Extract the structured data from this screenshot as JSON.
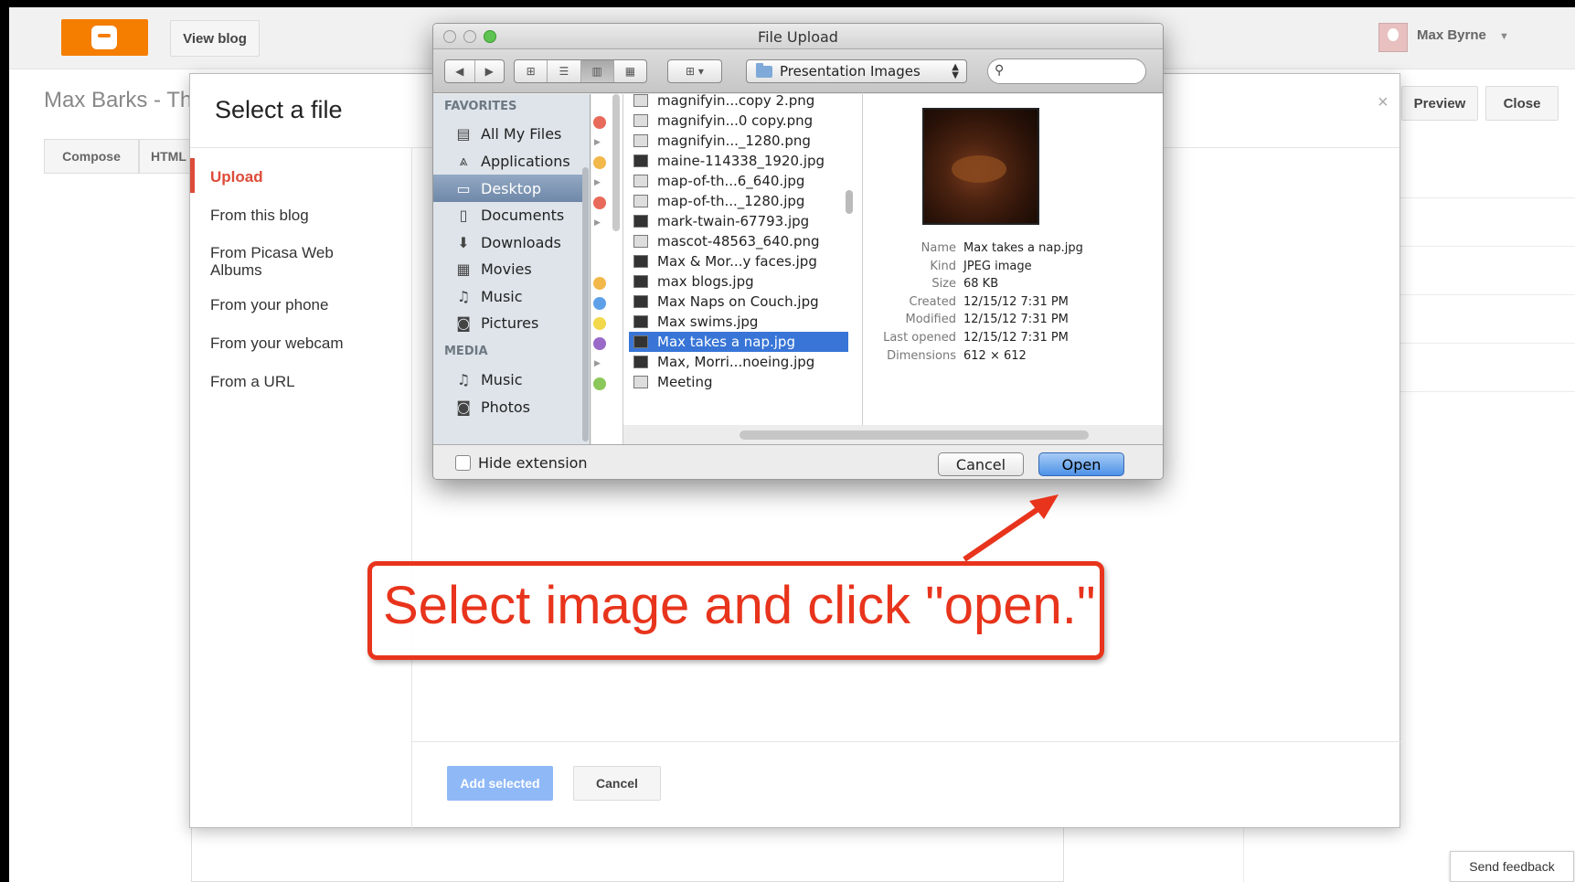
{
  "blogger": {
    "view_blog": "View blog",
    "user_name": "Max Byrne",
    "blog_title": "Max Barks - Th",
    "tab_compose": "Compose",
    "tab_html": "HTML",
    "preview": "Preview",
    "close": "Close",
    "send_feedback": "Send feedback"
  },
  "modal": {
    "title": "Select a file",
    "close_symbol": "×",
    "sidebar": [
      {
        "label": "Upload"
      },
      {
        "label": "From this blog"
      },
      {
        "label": "From Picasa Web Albums"
      },
      {
        "label": "From your phone"
      },
      {
        "label": "From your webcam"
      },
      {
        "label": "From a URL"
      }
    ],
    "add_selected": "Add selected",
    "cancel": "Cancel"
  },
  "dialog": {
    "title": "File Upload",
    "path": "Presentation Images",
    "search_placeholder": "",
    "favorites_header": "FAVORITES",
    "favorites": [
      {
        "label": "All My Files",
        "icon": "all-files-icon",
        "glyph": "▤"
      },
      {
        "label": "Applications",
        "icon": "applications-icon",
        "glyph": "⩓"
      },
      {
        "label": "Desktop",
        "icon": "desktop-icon",
        "glyph": "▭"
      },
      {
        "label": "Documents",
        "icon": "documents-icon",
        "glyph": "▯"
      },
      {
        "label": "Downloads",
        "icon": "downloads-icon",
        "glyph": "⬇"
      },
      {
        "label": "Movies",
        "icon": "movies-icon",
        "glyph": "▦"
      },
      {
        "label": "Music",
        "icon": "music-icon",
        "glyph": "♫"
      },
      {
        "label": "Pictures",
        "icon": "pictures-icon",
        "glyph": "◙"
      }
    ],
    "media_header": "MEDIA",
    "media": [
      {
        "label": "Music",
        "icon": "music-icon",
        "glyph": "♫"
      },
      {
        "label": "Photos",
        "icon": "photos-icon",
        "glyph": "◙"
      }
    ],
    "files": [
      "magnifyin...copy 2.png",
      "magnifyin...0 copy.png",
      "magnifyin..._1280.png",
      "maine-114338_1920.jpg",
      "map-of-th...6_640.jpg",
      "map-of-th..._1280.jpg",
      "mark-twain-67793.jpg",
      "mascot-48563_640.png",
      "Max & Mor...y faces.jpg",
      "max blogs.jpg",
      "Max Naps on Couch.jpg",
      "Max swims.jpg",
      "Max takes a nap.jpg",
      "Max, Morri...noeing.jpg",
      "Meeting"
    ],
    "info": [
      {
        "key": "Name",
        "value": "Max takes a nap.jpg"
      },
      {
        "key": "Kind",
        "value": "JPEG image"
      },
      {
        "key": "Size",
        "value": "68 KB"
      },
      {
        "key": "Created",
        "value": "12/15/12 7:31 PM"
      },
      {
        "key": "Modified",
        "value": "12/15/12 7:31 PM"
      },
      {
        "key": "Last opened",
        "value": "12/15/12 7:31 PM"
      },
      {
        "key": "Dimensions",
        "value": "612 × 612"
      }
    ],
    "hide_extension": "Hide extension",
    "cancel": "Cancel",
    "open": "Open"
  },
  "annotation": {
    "text": "Select image and click \"open.\"",
    "color": "#e8341c"
  }
}
